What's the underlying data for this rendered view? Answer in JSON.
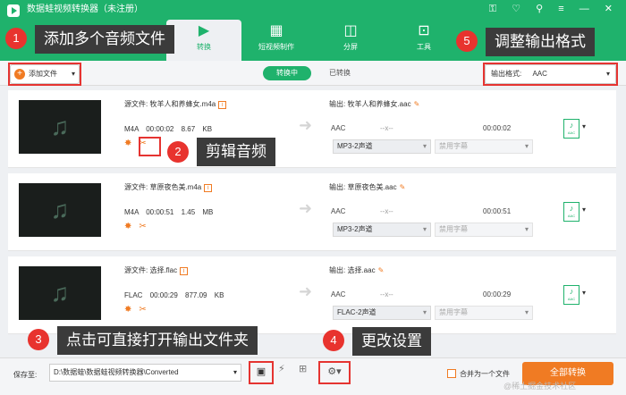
{
  "app": {
    "title": "数据蛙视频转换器（未注册）",
    "window_controls": "⚿ ♡ ⚲ ≡ — ✕"
  },
  "nav": [
    {
      "label": "转换",
      "icon": "convert-icon",
      "glyph": "▶"
    },
    {
      "label": "短视频制作",
      "icon": "image-icon",
      "glyph": "▦"
    },
    {
      "label": "分屏",
      "icon": "split-screen-icon",
      "glyph": "◫"
    },
    {
      "label": "工具",
      "icon": "toolbox-icon",
      "glyph": "⊡"
    }
  ],
  "toolbar": {
    "add_file_label": "添加文件",
    "tab_converting": "转换中",
    "tab_converted": "已转换",
    "output_format_label": "输出格式:",
    "output_format_value": "AAC"
  },
  "files": [
    {
      "source": "源文件: 牧羊人和养蜂女.m4a",
      "meta": "M4A 00:00:02 8.67 KB",
      "output": "输出: 牧羊人和养蜂女.aac",
      "codec": "AAC",
      "res": "--x--",
      "duration": "00:00:02",
      "channel": "MP3-2声道",
      "subtitle": "禁用字幕",
      "fmt_icon": "AAC"
    },
    {
      "source": "源文件: 草原夜色美.m4a",
      "meta": "M4A 00:00:51 1.45 MB",
      "output": "输出: 草原夜色美.aac",
      "codec": "AAC",
      "res": "--x--",
      "duration": "00:00:51",
      "channel": "MP3-2声道",
      "subtitle": "禁用字幕",
      "fmt_icon": "AAC"
    },
    {
      "source": "源文件: 选择.flac",
      "meta": "FLAC 00:00:29 877.09 KB",
      "output": "输出: 选择.aac",
      "codec": "AAC",
      "res": "--x--",
      "duration": "00:00:29",
      "channel": "FLAC-2声道",
      "subtitle": "禁用字幕",
      "fmt_icon": "AAC"
    }
  ],
  "bottom": {
    "save_label": "保存至:",
    "save_path": "D:\\数据蛙\\数据蛙视频转换器\\Converted",
    "merge_label": "合并为一个文件",
    "convert_all": "全部转换"
  },
  "annotations": [
    {
      "num": "1",
      "text": "添加多个音频文件"
    },
    {
      "num": "2",
      "text": "剪辑音频"
    },
    {
      "num": "3",
      "text": "点击可直接打开输出文件夹"
    },
    {
      "num": "4",
      "text": "更改设置"
    },
    {
      "num": "5",
      "text": "调整输出格式"
    }
  ],
  "watermark": "@稀土掘金技术社区",
  "colors": {
    "brand": "#1fb26c",
    "accent": "#f07b23",
    "annotation_red": "#e53431",
    "callout_bg": "#3b3b3b"
  }
}
